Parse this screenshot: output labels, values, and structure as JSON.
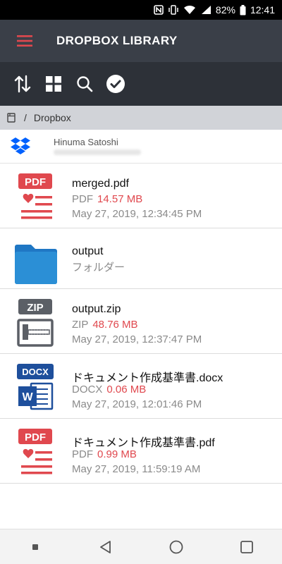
{
  "status_bar": {
    "battery": "82%",
    "time": "12:41",
    "icons": [
      "nfc-icon",
      "vibrate-icon",
      "wifi-icon",
      "signal-icon",
      "battery-icon"
    ]
  },
  "app_bar": {
    "title": "DROPBOX LIBRARY",
    "menu_icon": "hamburger-icon"
  },
  "toolbar": {
    "icons": [
      "sort-icon",
      "grid-view-icon",
      "search-icon",
      "select-all-icon"
    ]
  },
  "breadcrumb": {
    "separator": "/",
    "path": "Dropbox"
  },
  "account": {
    "name": "Hinuma Satoshi"
  },
  "files": [
    {
      "name": "merged.pdf",
      "type": "PDF",
      "size": "14.57 MB",
      "date": "May 27, 2019, 12:34:45 PM",
      "icon": "pdf-file-icon"
    },
    {
      "name": "output",
      "type": "フォルダー",
      "icon": "folder-icon"
    },
    {
      "name": "output.zip",
      "type": "ZIP",
      "size": "48.76 MB",
      "date": "May 27, 2019, 12:37:47 PM",
      "icon": "zip-file-icon"
    },
    {
      "name": "ドキュメント作成基準書.docx",
      "type": "DOCX",
      "size": "0.06 MB",
      "date": "May 27, 2019, 12:01:46 PM",
      "icon": "docx-file-icon"
    },
    {
      "name": "ドキュメント作成基準書.pdf",
      "type": "PDF",
      "size": "0.99 MB",
      "date": "May 27, 2019, 11:59:19 AM",
      "icon": "pdf-file-icon"
    }
  ],
  "colors": {
    "accent_red": "#e0484e",
    "appbar": "#3a3f48",
    "toolbar": "#2d3138",
    "breadcrumb": "#d1d3d8",
    "folder_blue": "#2b8fd6",
    "dropbox_blue": "#0061fe"
  }
}
